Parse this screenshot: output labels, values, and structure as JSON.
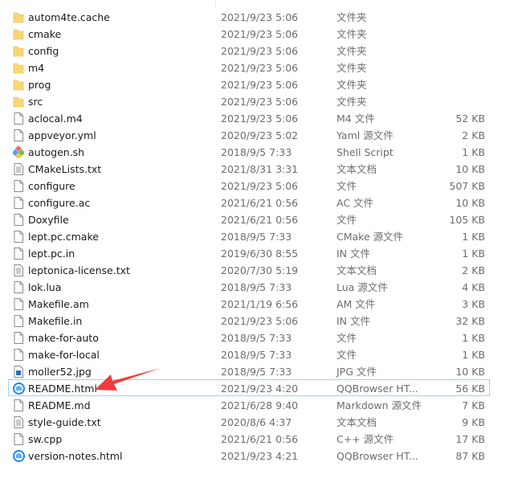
{
  "colors": {
    "folder": "#f8d775",
    "selection_border": "#99d1ff",
    "arrow": "#f03c3c"
  },
  "files": [
    {
      "name": "autom4te.cache",
      "date": "2021/9/23 5:06",
      "type": "文件夹",
      "size": "",
      "icon": "folder-icon"
    },
    {
      "name": "cmake",
      "date": "2021/9/23 5:06",
      "type": "文件夹",
      "size": "",
      "icon": "folder-icon"
    },
    {
      "name": "config",
      "date": "2021/9/23 5:06",
      "type": "文件夹",
      "size": "",
      "icon": "folder-icon"
    },
    {
      "name": "m4",
      "date": "2021/9/23 5:06",
      "type": "文件夹",
      "size": "",
      "icon": "folder-icon"
    },
    {
      "name": "prog",
      "date": "2021/9/23 5:06",
      "type": "文件夹",
      "size": "",
      "icon": "folder-icon"
    },
    {
      "name": "src",
      "date": "2021/9/23 5:06",
      "type": "文件夹",
      "size": "",
      "icon": "folder-icon"
    },
    {
      "name": "aclocal.m4",
      "date": "2021/9/23 5:06",
      "type": "M4 文件",
      "size": "52 KB",
      "icon": "file-icon"
    },
    {
      "name": "appveyor.yml",
      "date": "2020/9/23 5:02",
      "type": "Yaml 源文件",
      "size": "2 KB",
      "icon": "file-icon"
    },
    {
      "name": "autogen.sh",
      "date": "2018/9/5 7:33",
      "type": "Shell Script",
      "size": "1 KB",
      "icon": "git-icon"
    },
    {
      "name": "CMakeLists.txt",
      "date": "2021/8/31 3:31",
      "type": "文本文档",
      "size": "10 KB",
      "icon": "text-file-icon"
    },
    {
      "name": "configure",
      "date": "2021/9/23 5:06",
      "type": "文件",
      "size": "507 KB",
      "icon": "file-icon"
    },
    {
      "name": "configure.ac",
      "date": "2021/6/21 0:56",
      "type": "AC 文件",
      "size": "10 KB",
      "icon": "file-icon"
    },
    {
      "name": "Doxyfile",
      "date": "2021/6/21 0:56",
      "type": "文件",
      "size": "105 KB",
      "icon": "file-icon"
    },
    {
      "name": "lept.pc.cmake",
      "date": "2018/9/5 7:33",
      "type": "CMake 源文件",
      "size": "1 KB",
      "icon": "file-icon"
    },
    {
      "name": "lept.pc.in",
      "date": "2019/6/30 8:55",
      "type": "IN 文件",
      "size": "1 KB",
      "icon": "file-icon"
    },
    {
      "name": "leptonica-license.txt",
      "date": "2020/7/30 5:19",
      "type": "文本文档",
      "size": "2 KB",
      "icon": "text-file-icon"
    },
    {
      "name": "lok.lua",
      "date": "2018/9/5 7:33",
      "type": "Lua 源文件",
      "size": "4 KB",
      "icon": "file-icon"
    },
    {
      "name": "Makefile.am",
      "date": "2021/1/19 6:56",
      "type": "AM 文件",
      "size": "3 KB",
      "icon": "file-icon"
    },
    {
      "name": "Makefile.in",
      "date": "2021/9/23 5:06",
      "type": "IN 文件",
      "size": "32 KB",
      "icon": "file-icon"
    },
    {
      "name": "make-for-auto",
      "date": "2018/9/5 7:33",
      "type": "文件",
      "size": "1 KB",
      "icon": "file-icon"
    },
    {
      "name": "make-for-local",
      "date": "2018/9/5 7:33",
      "type": "文件",
      "size": "1 KB",
      "icon": "file-icon"
    },
    {
      "name": "moller52.jpg",
      "date": "2018/9/5 7:33",
      "type": "JPG 文件",
      "size": "10 KB",
      "icon": "image-file-icon"
    },
    {
      "name": "README.html",
      "date": "2021/9/23 4:20",
      "type": "QQBrowser HT...",
      "size": "56 KB",
      "icon": "browser-icon",
      "selected": true
    },
    {
      "name": "README.md",
      "date": "2021/6/28 9:40",
      "type": "Markdown 源文件",
      "size": "7 KB",
      "icon": "file-icon"
    },
    {
      "name": "style-guide.txt",
      "date": "2020/8/6 4:37",
      "type": "文本文档",
      "size": "9 KB",
      "icon": "text-file-icon"
    },
    {
      "name": "sw.cpp",
      "date": "2021/6/21 0:56",
      "type": "C++ 源文件",
      "size": "17 KB",
      "icon": "file-icon"
    },
    {
      "name": "version-notes.html",
      "date": "2021/9/23 4:21",
      "type": "QQBrowser HT...",
      "size": "87 KB",
      "icon": "browser-icon"
    }
  ]
}
